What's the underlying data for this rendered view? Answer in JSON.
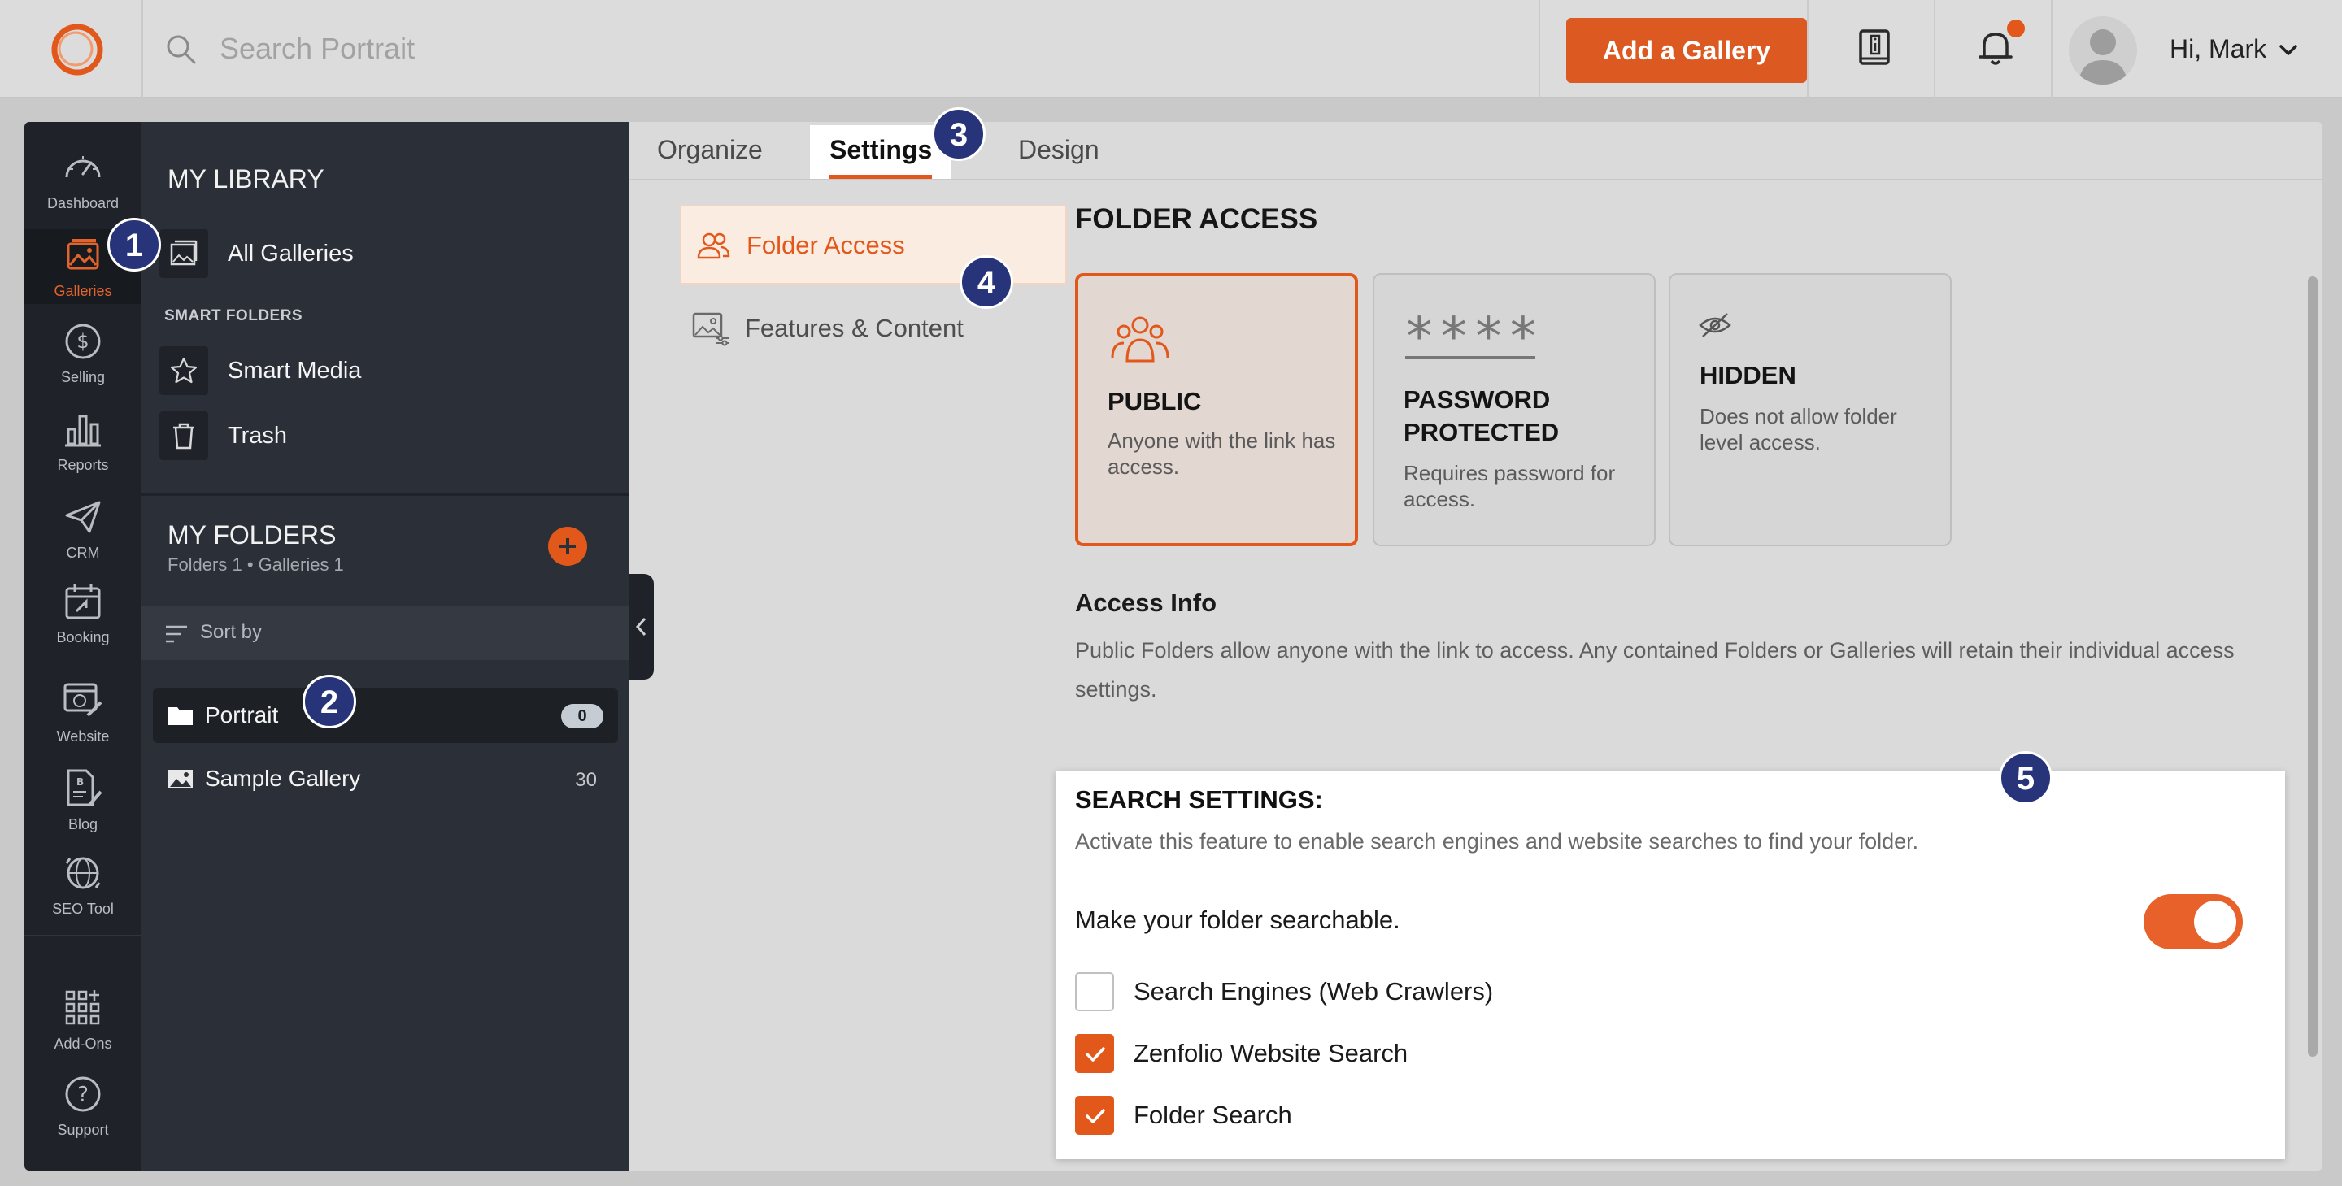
{
  "topbar": {
    "search_placeholder": "Search Portrait",
    "add_gallery_label": "Add a Gallery",
    "greeting": "Hi, Mark"
  },
  "rail": {
    "items": [
      {
        "label": "Dashboard",
        "icon": "gauge-icon"
      },
      {
        "label": "Galleries",
        "icon": "image-icon"
      },
      {
        "label": "Selling",
        "icon": "dollar-icon"
      },
      {
        "label": "Reports",
        "icon": "bar-chart-icon"
      },
      {
        "label": "CRM",
        "icon": "paper-plane-icon"
      },
      {
        "label": "Booking",
        "icon": "calendar-icon"
      },
      {
        "label": "Website",
        "icon": "website-edit-icon"
      },
      {
        "label": "Blog",
        "icon": "blog-edit-icon"
      },
      {
        "label": "SEO Tool",
        "icon": "globe-search-icon"
      },
      {
        "label": "Add-Ons",
        "icon": "grid-plus-icon"
      },
      {
        "label": "Support",
        "icon": "question-icon"
      }
    ]
  },
  "library": {
    "title": "MY LIBRARY",
    "all_galleries": "All Galleries",
    "smart_folders_label": "SMART FOLDERS",
    "smart_media": "Smart Media",
    "trash": "Trash",
    "my_folders_title": "MY FOLDERS",
    "folders_summary": "Folders 1 • Galleries 1",
    "sort_by": "Sort by",
    "folders": [
      {
        "name": "Portrait",
        "count": "0"
      },
      {
        "name": "Sample Gallery",
        "count": "30"
      }
    ]
  },
  "tabs": {
    "organize": "Organize",
    "settings": "Settings",
    "design": "Design"
  },
  "subnav": {
    "folder_access": "Folder Access",
    "features_content": "Features & Content"
  },
  "folder_access": {
    "title": "FOLDER ACCESS",
    "cards": [
      {
        "title": "PUBLIC",
        "desc": "Anyone with the link has access."
      },
      {
        "title": "PASSWORD PROTECTED",
        "desc": "Requires password for access."
      },
      {
        "title": "HIDDEN",
        "desc": "Does not allow folder level access."
      }
    ],
    "password_mask": "****",
    "info_title": "Access Info",
    "info_text": "Public Folders allow anyone with the link to access. Any contained Folders or Galleries will retain their individual access settings."
  },
  "search_settings": {
    "title": "SEARCH SETTINGS:",
    "desc": "Activate this feature to enable search engines and website searches to find your folder.",
    "make_searchable": "Make your folder searchable.",
    "toggle_on": true,
    "options": [
      {
        "label": "Search Engines (Web Crawlers)",
        "checked": false
      },
      {
        "label": "Zenfolio Website Search",
        "checked": true
      },
      {
        "label": "Folder Search",
        "checked": true
      }
    ]
  },
  "markers": [
    "1",
    "2",
    "3",
    "4",
    "5"
  ],
  "colors": {
    "accent": "#e2581b",
    "rail_bg": "#1f2329",
    "library_bg": "#2b3038",
    "marker_bg": "#27347a"
  }
}
